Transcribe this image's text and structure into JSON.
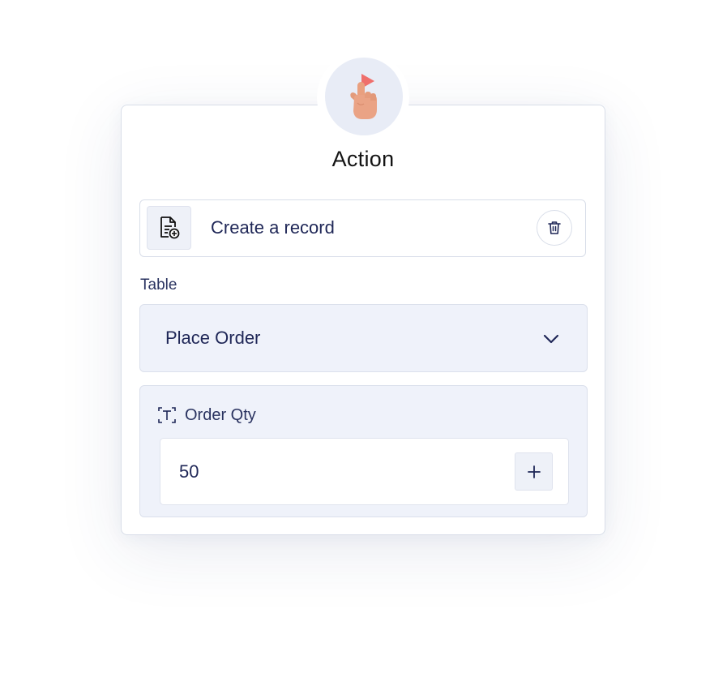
{
  "header": {
    "title": "Action",
    "badge_icon": "pointing-hand-play-icon"
  },
  "action": {
    "label": "Create a record",
    "icon": "document-add-icon",
    "delete_icon": "trash-icon"
  },
  "table": {
    "label": "Table",
    "selected": "Place Order",
    "dropdown_icon": "chevron-down-icon"
  },
  "field": {
    "label": "Order Qty",
    "type_icon": "text-field-icon",
    "value": "50",
    "add_icon": "plus-icon"
  },
  "colors": {
    "text_primary": "#1f2757",
    "panel_bg": "#eff2fa",
    "border": "#d9dee9",
    "hand": "#e9a07f",
    "play": "#ef6f6c"
  }
}
